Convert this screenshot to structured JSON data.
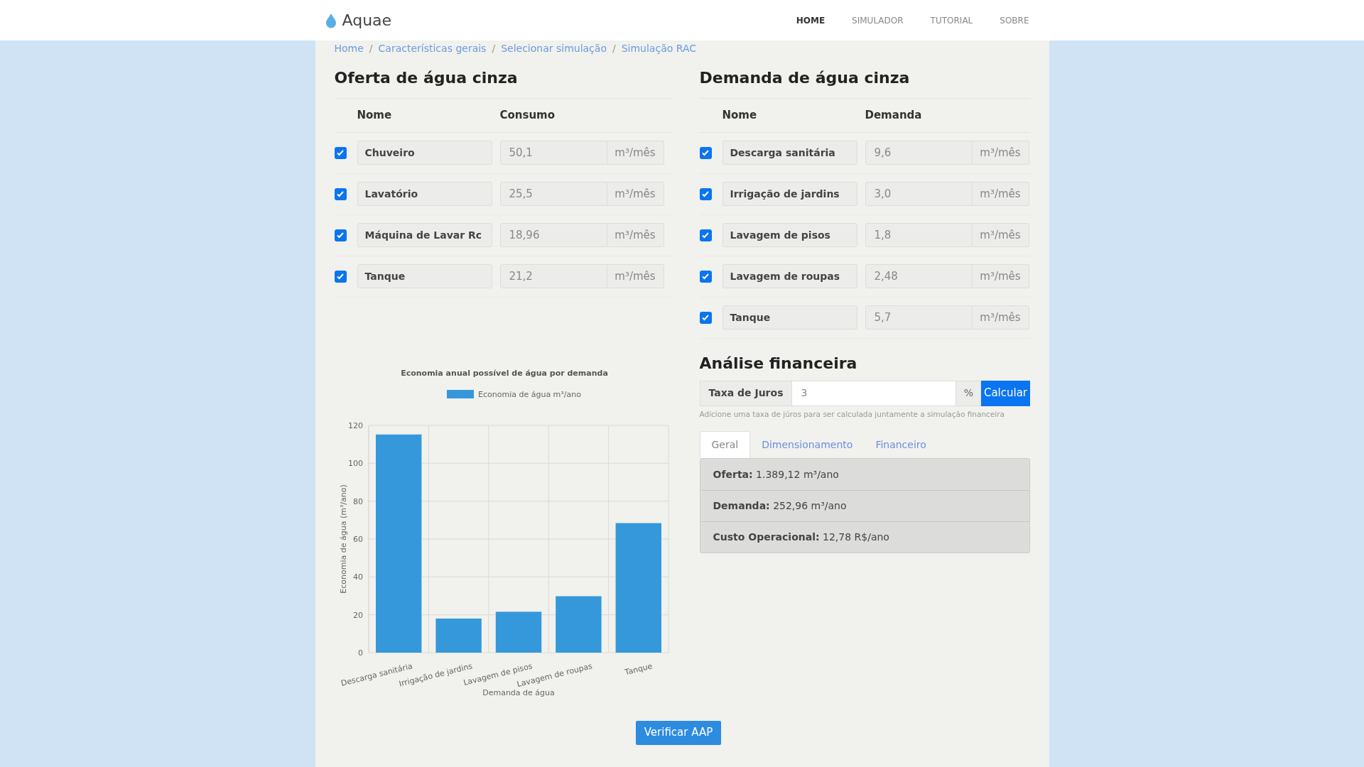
{
  "brand": "Aquae",
  "nav": [
    {
      "label": "HOME",
      "selected": true
    },
    {
      "label": "SIMULADOR",
      "selected": false
    },
    {
      "label": "TUTORIAL",
      "selected": false
    },
    {
      "label": "SOBRE",
      "selected": false
    }
  ],
  "breadcrumb": [
    "Home",
    "Características gerais",
    "Selecionar simulação",
    "Simulação RAC"
  ],
  "breadcrumb_separators": [
    "/",
    "/",
    "/"
  ],
  "supply": {
    "title": "Oferta de água cinza",
    "columns": [
      "Nome",
      "Consumo"
    ],
    "rows": [
      {
        "checked": true,
        "name": "Chuveiro",
        "value": "50,1",
        "unit": "m³/mês"
      },
      {
        "checked": true,
        "name": "Lavatório",
        "value": "25,5",
        "unit": "m³/mês"
      },
      {
        "checked": true,
        "name": "Máquina de Lavar Rc",
        "value": "18,96",
        "unit": "m³/mês"
      },
      {
        "checked": true,
        "name": "Tanque",
        "value": "21,2",
        "unit": "m³/mês"
      }
    ]
  },
  "demand": {
    "title": "Demanda de água cinza",
    "columns": [
      "Nome",
      "Demanda"
    ],
    "rows": [
      {
        "checked": true,
        "name": "Descarga sanitária",
        "value": "9,6",
        "unit": "m³/mês"
      },
      {
        "checked": true,
        "name": "Irrigação de jardins",
        "value": "3,0",
        "unit": "m³/mês"
      },
      {
        "checked": true,
        "name": "Lavagem de pisos",
        "value": "1,8",
        "unit": "m³/mês"
      },
      {
        "checked": true,
        "name": "Lavagem de roupas",
        "value": "2,48",
        "unit": "m³/mês"
      },
      {
        "checked": true,
        "name": "Tanque",
        "value": "5,7",
        "unit": "m³/mês"
      }
    ]
  },
  "chart": {
    "chart_data": {
      "type": "bar",
      "title": "Economia anual possível de água por demanda",
      "xlabel": "Demanda de água",
      "ylabel": "Economia de água (m³/ano)",
      "categories": [
        "Descarga sanitária",
        "Irrigação de jardins",
        "Lavagem de pisos",
        "Lavagem de roupas",
        "Tanque"
      ],
      "series": [
        {
          "name": "Economia de água m³/ano",
          "color": "#3498db",
          "values": [
            115.2,
            18,
            21.6,
            29.8,
            68.4
          ]
        }
      ],
      "grid": true,
      "ylim": [
        0,
        120
      ],
      "yticks": [
        0,
        20,
        40,
        60,
        80,
        100,
        120
      ]
    }
  },
  "finance": {
    "title": "Análise financeira",
    "rate_label": "Taxa de Juros",
    "rate_value": "3",
    "rate_suffix": "%",
    "calc_button": "Calcular",
    "help": "Adicione uma taxa de júros para ser calculada juntamente a simulação financeira",
    "tabs": [
      {
        "label": "Geral",
        "selected": true
      },
      {
        "label": "Dimensionamento",
        "selected": false
      },
      {
        "label": "Financeiro",
        "selected": false
      }
    ],
    "results": [
      "**Oferta:** 1.389,12 m³/ano",
      "**Demanda:** 252,96 m³/ano",
      "**Custo Operacional:** 12,78 R$/ano"
    ]
  },
  "verify_button": "Verificar AAP"
}
